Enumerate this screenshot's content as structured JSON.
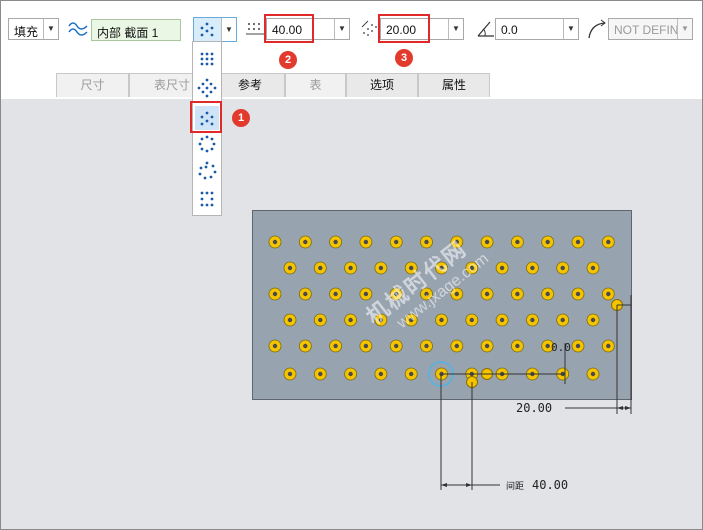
{
  "toolbar": {
    "fill_type": "填充",
    "section_name": "内部 截面 1",
    "spacing1_value": "40.00",
    "spacing2_value": "20.00",
    "angle_value": "0.0",
    "not_defined": "NOT DEFIN"
  },
  "tabs": [
    {
      "label": "尺寸",
      "active": false
    },
    {
      "label": "表尺寸",
      "active": false
    },
    {
      "label": "参考",
      "active": true
    },
    {
      "label": "表",
      "active": false
    },
    {
      "label": "选项",
      "active": true
    },
    {
      "label": "属性",
      "active": true
    }
  ],
  "badges": [
    "1",
    "2",
    "3"
  ],
  "dimensions": {
    "horizontal": "20.00",
    "spacing_label": "间距",
    "spacing_value": "40.00",
    "side_value": "0.0"
  },
  "watermark": [
    "机械时代网",
    "www.jxage.com"
  ],
  "colors": {
    "accent": "#e02a2a",
    "hole": "#f4c400",
    "plate": "#98a3b0",
    "icon_blue": "#1a5aa8"
  }
}
